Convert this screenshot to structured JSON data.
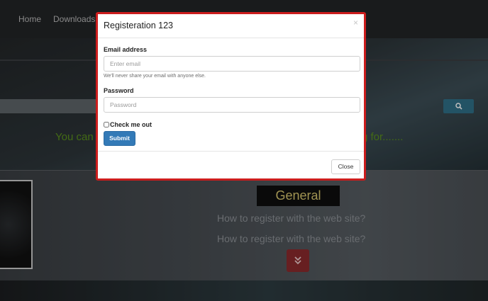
{
  "nav": {
    "items": [
      {
        "label": "Home"
      },
      {
        "label": "Downloads"
      }
    ]
  },
  "hero": {
    "text_left": "You can",
    "text_right": "g for.......",
    "search_icon": "search-icon"
  },
  "content": {
    "category": "General",
    "faqs": [
      {
        "text": "How to register with the web site?"
      },
      {
        "text": "How to register with the web site?"
      }
    ],
    "expand_icon": "double-chevron-down-icon"
  },
  "modal": {
    "title": "Registeration 123",
    "close_glyph": "×",
    "email_label": "Email address",
    "email_placeholder": "Enter email",
    "email_help": "We'll never share your email with anyone else.",
    "password_label": "Password",
    "password_placeholder": "Password",
    "checkbox_label": "Check me out",
    "checkbox_checked": false,
    "submit_label": "Submit",
    "close_label": "Close"
  },
  "colors": {
    "modal_border": "#cc1d1d",
    "primary_button": "#337ab7",
    "hero_text": "#5a8f1c",
    "category_text": "#d6c46e",
    "expand_button": "#8a2a2c",
    "search_button": "#2f6f87"
  }
}
